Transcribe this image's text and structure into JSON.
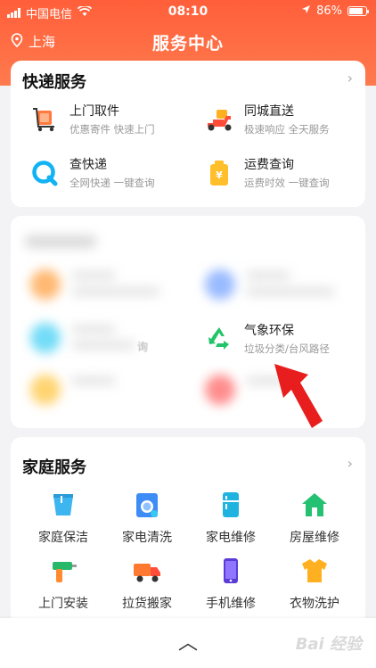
{
  "status_bar": {
    "carrier": "中国电信",
    "time": "08:10",
    "battery": "86%"
  },
  "nav": {
    "location": "上海",
    "title": "服务中心"
  },
  "express": {
    "title": "快递服务",
    "items": [
      {
        "name": "上门取件",
        "desc": "优惠寄件 快速上门"
      },
      {
        "name": "同城直送",
        "desc": "极速响应 全天服务"
      },
      {
        "name": "查快递",
        "desc": "全网快递 一键查询"
      },
      {
        "name": "运费查询",
        "desc": "运费时效 一键查询"
      }
    ]
  },
  "blurred_section": {
    "highlight": {
      "name": "气象环保",
      "desc": "垃圾分类/台风路径"
    },
    "partial_text": "询"
  },
  "home": {
    "title": "家庭服务",
    "items": [
      "家庭保洁",
      "家电清洗",
      "家电维修",
      "房屋维修",
      "上门安装",
      "拉货搬家",
      "手机维修",
      "衣物洗护"
    ]
  },
  "bottom": {
    "chevron": "︿"
  },
  "watermark": {
    "text": "Bai 经验"
  },
  "colors": {
    "brand": "#ff6a45",
    "arrow": "#e81e1e"
  }
}
